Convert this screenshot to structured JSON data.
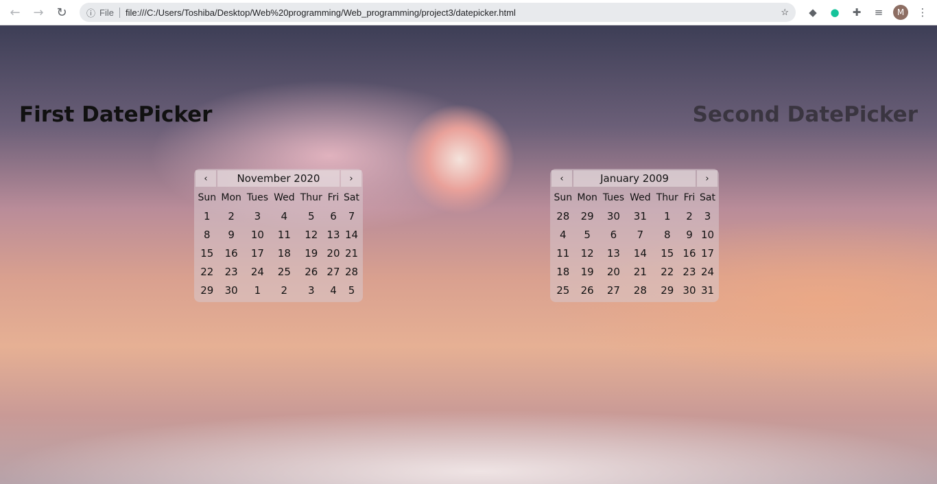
{
  "browser": {
    "file_label": "File",
    "url": "file:///C:/Users/Toshiba/Desktop/Web%20programming/Web_programming/project3/datepicker.html",
    "profile_initial": "M"
  },
  "page": {
    "title1": "First DatePicker",
    "title2": "Second DatePicker"
  },
  "weekdays": [
    "Sun",
    "Mon",
    "Tues",
    "Wed",
    "Thur",
    "Fri",
    "Sat"
  ],
  "nav": {
    "prev": "‹",
    "next": "›"
  },
  "calendars": [
    {
      "month": "November 2020",
      "weeks": [
        [
          "1",
          "2",
          "3",
          "4",
          "5",
          "6",
          "7"
        ],
        [
          "8",
          "9",
          "10",
          "11",
          "12",
          "13",
          "14"
        ],
        [
          "15",
          "16",
          "17",
          "18",
          "19",
          "20",
          "21"
        ],
        [
          "22",
          "23",
          "24",
          "25",
          "26",
          "27",
          "28"
        ],
        [
          "29",
          "30",
          "1",
          "2",
          "3",
          "4",
          "5"
        ]
      ]
    },
    {
      "month": "January 2009",
      "weeks": [
        [
          "28",
          "29",
          "30",
          "31",
          "1",
          "2",
          "3"
        ],
        [
          "4",
          "5",
          "6",
          "7",
          "8",
          "9",
          "10"
        ],
        [
          "11",
          "12",
          "13",
          "14",
          "15",
          "16",
          "17"
        ],
        [
          "18",
          "19",
          "20",
          "21",
          "22",
          "23",
          "24"
        ],
        [
          "25",
          "26",
          "27",
          "28",
          "29",
          "30",
          "31"
        ]
      ]
    }
  ]
}
